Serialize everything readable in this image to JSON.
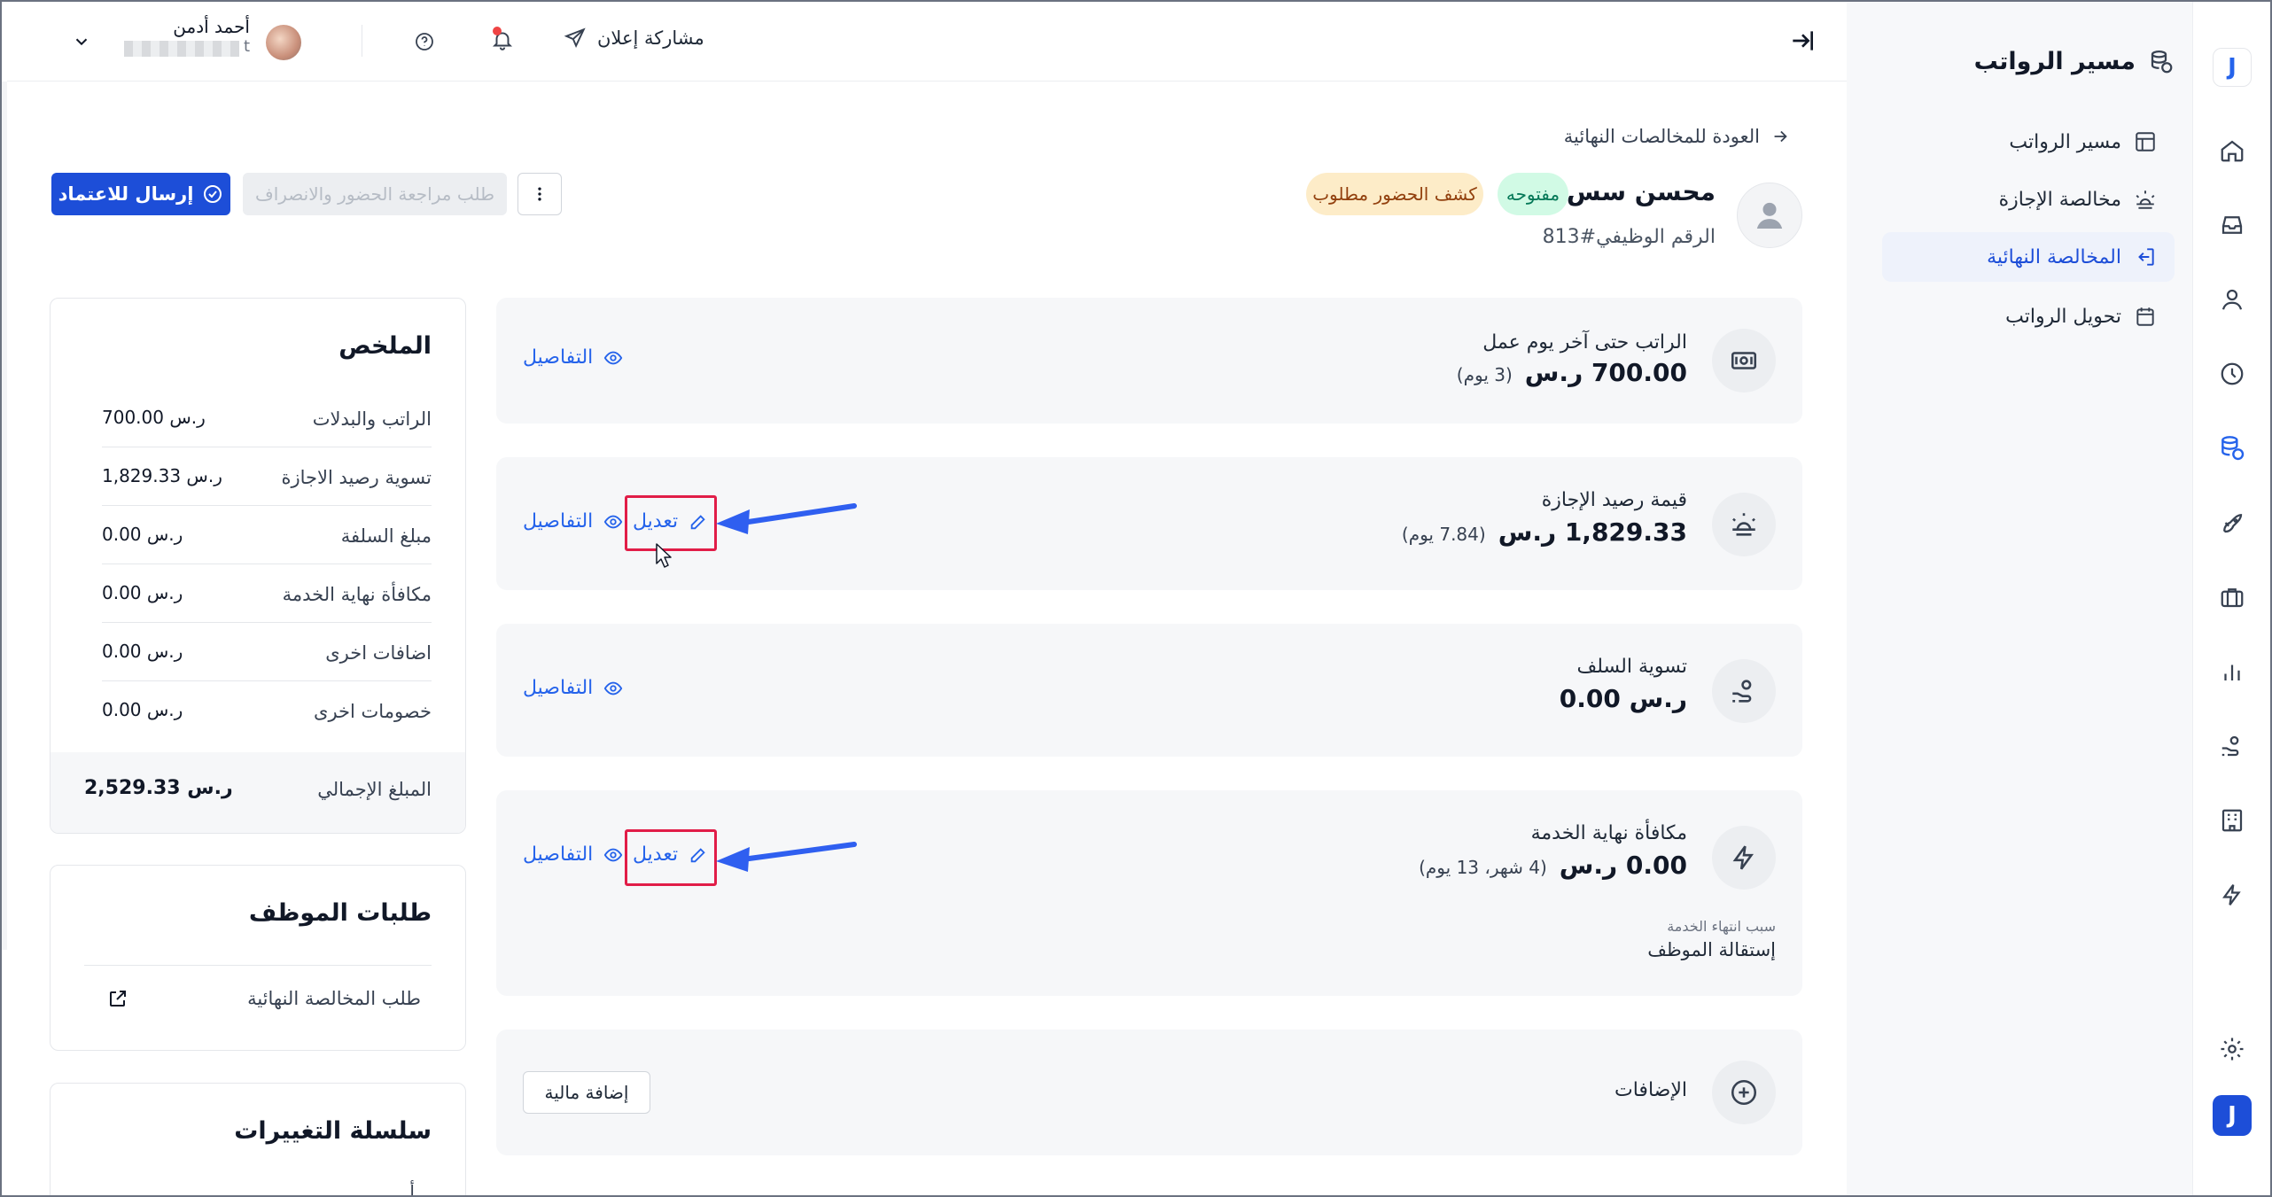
{
  "header": {
    "user_name": "أحمد أدمن",
    "user_sub": "t",
    "share_announcement": "مشاركة إعلان"
  },
  "sidebar": {
    "title": "مسير الرواتب",
    "items": [
      {
        "label": "مسير الرواتب",
        "icon": "table-icon",
        "active": false
      },
      {
        "label": "مخالصة الإجازة",
        "icon": "sunset-icon",
        "active": false
      },
      {
        "label": "المخالصة النهائية",
        "icon": "logout-icon",
        "active": true
      },
      {
        "label": "تحويل الرواتب",
        "icon": "calendar-icon",
        "active": false
      }
    ]
  },
  "page": {
    "back_link": "العودة للمخالصات النهائية",
    "employee_name": "محسن سس",
    "status_badge": "مفتوحه",
    "attendance_badge": "كشف الحضور مطلوب",
    "employee_id": "الرقم الوظيفي#813",
    "send_for_approval": "إرسال للاعتماد",
    "request_attendance_review": "طلب مراجعة الحضور والانصراف"
  },
  "cards": {
    "salary": {
      "title": "الراتب حتى آخر يوم عمل",
      "amount": "700.00 ر.س",
      "sub": "(3 يوم)",
      "details": "التفاصيل"
    },
    "leave": {
      "title": "قيمة رصيد الإجازة",
      "amount": "1,829.33 ر.س",
      "sub": "(7.84 يوم)",
      "details": "التفاصيل",
      "edit": "تعديل"
    },
    "advances": {
      "title": "تسوية السلف",
      "amount": "0.00 ر.س",
      "details": "التفاصيل"
    },
    "eos": {
      "title": "مكافأة نهاية الخدمة",
      "amount": "0.00 ر.س",
      "sub": "(4 شهر، 13 يوم)",
      "details": "التفاصيل",
      "edit": "تعديل",
      "reason_label": "سبب انتهاء الخدمة",
      "reason_value": "إستقالة الموظف"
    },
    "additions": {
      "title": "الإضافات",
      "add_button": "إضافة مالية"
    }
  },
  "summary": {
    "title": "الملخص",
    "rows": [
      {
        "label": "الراتب والبدلات",
        "value": "700.00 ر.س"
      },
      {
        "label": "تسوية رصيد الاجازة",
        "value": "1,829.33 ر.س"
      },
      {
        "label": "مبلغ السلفة",
        "value": "0.00 ر.س"
      },
      {
        "label": "مكافأة نهاية الخدمة",
        "value": "0.00 ر.س"
      },
      {
        "label": "اضافات اخرى",
        "value": "0.00 ر.س"
      },
      {
        "label": "خصومات اخرى",
        "value": "0.00 ر.س"
      }
    ],
    "total_label": "المبلغ الإجمالي",
    "total_value": "2,529.33 ر.س"
  },
  "employee_requests": {
    "title": "طلبات الموظف",
    "item": "طلب المخالصة النهائية"
  },
  "changes": {
    "title": "سلسلة التغييرات",
    "partial_text": "أ..."
  },
  "colors": {
    "primary": "#2563eb",
    "annotation_arrow": "#2f5ff0",
    "annotation_box": "#e11d48",
    "badge_open_bg": "#d1fae5",
    "badge_attendance_bg": "#fdecc8"
  }
}
